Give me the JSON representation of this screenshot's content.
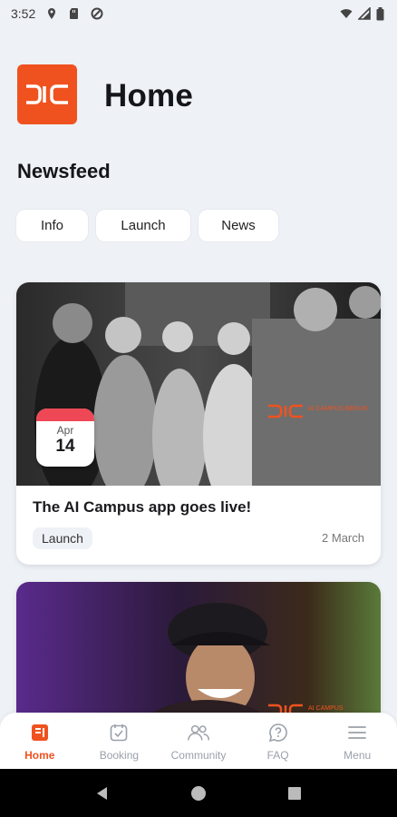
{
  "status_bar": {
    "time": "3:52"
  },
  "header": {
    "title": "Home",
    "logo_icon": "dic-logo-icon"
  },
  "newsfeed": {
    "title": "Newsfeed",
    "filters": [
      {
        "label": "Info"
      },
      {
        "label": "Launch"
      },
      {
        "label": "News"
      }
    ]
  },
  "cards": [
    {
      "date_month": "Apr",
      "date_day": "14",
      "title": "The AI Campus app goes live!",
      "tag": "Launch",
      "posted": "2 March",
      "photo_logo_text": "AI CAMPUS BERLIN"
    },
    {
      "photo_logo_text": "AI CAMPUS"
    }
  ],
  "bottom_nav": [
    {
      "label": "Home",
      "icon": "home-icon",
      "active": true
    },
    {
      "label": "Booking",
      "icon": "booking-icon",
      "active": false
    },
    {
      "label": "Community",
      "icon": "community-icon",
      "active": false
    },
    {
      "label": "FAQ",
      "icon": "faq-icon",
      "active": false
    },
    {
      "label": "Menu",
      "icon": "menu-icon",
      "active": false
    }
  ],
  "colors": {
    "accent": "#f0521f",
    "background": "#eef1f6",
    "date_badge": "#ee4755"
  }
}
